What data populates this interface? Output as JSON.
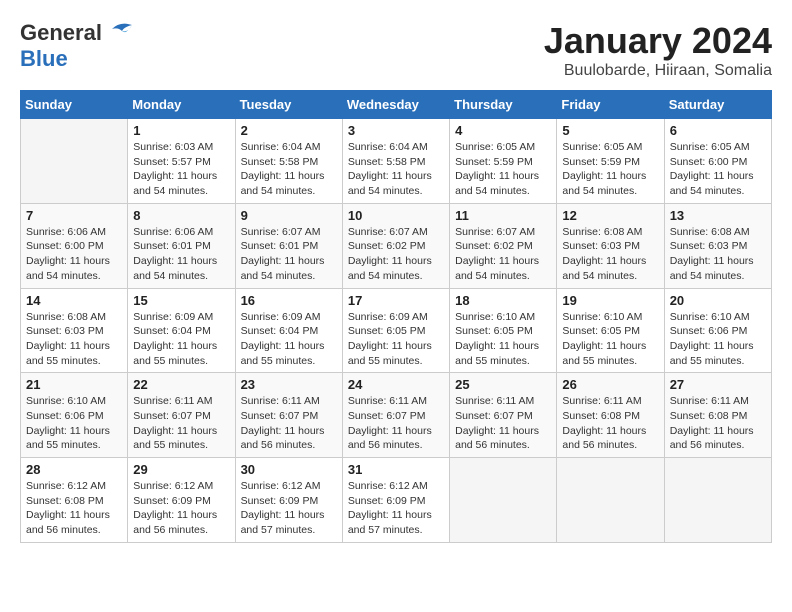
{
  "logo": {
    "general": "General",
    "blue": "Blue"
  },
  "title": "January 2024",
  "subtitle": "Buulobarde, Hiiraan, Somalia",
  "weekdays": [
    "Sunday",
    "Monday",
    "Tuesday",
    "Wednesday",
    "Thursday",
    "Friday",
    "Saturday"
  ],
  "weeks": [
    [
      {
        "day": "",
        "info": ""
      },
      {
        "day": "1",
        "info": "Sunrise: 6:03 AM\nSunset: 5:57 PM\nDaylight: 11 hours\nand 54 minutes."
      },
      {
        "day": "2",
        "info": "Sunrise: 6:04 AM\nSunset: 5:58 PM\nDaylight: 11 hours\nand 54 minutes."
      },
      {
        "day": "3",
        "info": "Sunrise: 6:04 AM\nSunset: 5:58 PM\nDaylight: 11 hours\nand 54 minutes."
      },
      {
        "day": "4",
        "info": "Sunrise: 6:05 AM\nSunset: 5:59 PM\nDaylight: 11 hours\nand 54 minutes."
      },
      {
        "day": "5",
        "info": "Sunrise: 6:05 AM\nSunset: 5:59 PM\nDaylight: 11 hours\nand 54 minutes."
      },
      {
        "day": "6",
        "info": "Sunrise: 6:05 AM\nSunset: 6:00 PM\nDaylight: 11 hours\nand 54 minutes."
      }
    ],
    [
      {
        "day": "7",
        "info": "Sunrise: 6:06 AM\nSunset: 6:00 PM\nDaylight: 11 hours\nand 54 minutes."
      },
      {
        "day": "8",
        "info": "Sunrise: 6:06 AM\nSunset: 6:01 PM\nDaylight: 11 hours\nand 54 minutes."
      },
      {
        "day": "9",
        "info": "Sunrise: 6:07 AM\nSunset: 6:01 PM\nDaylight: 11 hours\nand 54 minutes."
      },
      {
        "day": "10",
        "info": "Sunrise: 6:07 AM\nSunset: 6:02 PM\nDaylight: 11 hours\nand 54 minutes."
      },
      {
        "day": "11",
        "info": "Sunrise: 6:07 AM\nSunset: 6:02 PM\nDaylight: 11 hours\nand 54 minutes."
      },
      {
        "day": "12",
        "info": "Sunrise: 6:08 AM\nSunset: 6:03 PM\nDaylight: 11 hours\nand 54 minutes."
      },
      {
        "day": "13",
        "info": "Sunrise: 6:08 AM\nSunset: 6:03 PM\nDaylight: 11 hours\nand 54 minutes."
      }
    ],
    [
      {
        "day": "14",
        "info": "Sunrise: 6:08 AM\nSunset: 6:03 PM\nDaylight: 11 hours\nand 55 minutes."
      },
      {
        "day": "15",
        "info": "Sunrise: 6:09 AM\nSunset: 6:04 PM\nDaylight: 11 hours\nand 55 minutes."
      },
      {
        "day": "16",
        "info": "Sunrise: 6:09 AM\nSunset: 6:04 PM\nDaylight: 11 hours\nand 55 minutes."
      },
      {
        "day": "17",
        "info": "Sunrise: 6:09 AM\nSunset: 6:05 PM\nDaylight: 11 hours\nand 55 minutes."
      },
      {
        "day": "18",
        "info": "Sunrise: 6:10 AM\nSunset: 6:05 PM\nDaylight: 11 hours\nand 55 minutes."
      },
      {
        "day": "19",
        "info": "Sunrise: 6:10 AM\nSunset: 6:05 PM\nDaylight: 11 hours\nand 55 minutes."
      },
      {
        "day": "20",
        "info": "Sunrise: 6:10 AM\nSunset: 6:06 PM\nDaylight: 11 hours\nand 55 minutes."
      }
    ],
    [
      {
        "day": "21",
        "info": "Sunrise: 6:10 AM\nSunset: 6:06 PM\nDaylight: 11 hours\nand 55 minutes."
      },
      {
        "day": "22",
        "info": "Sunrise: 6:11 AM\nSunset: 6:07 PM\nDaylight: 11 hours\nand 55 minutes."
      },
      {
        "day": "23",
        "info": "Sunrise: 6:11 AM\nSunset: 6:07 PM\nDaylight: 11 hours\nand 56 minutes."
      },
      {
        "day": "24",
        "info": "Sunrise: 6:11 AM\nSunset: 6:07 PM\nDaylight: 11 hours\nand 56 minutes."
      },
      {
        "day": "25",
        "info": "Sunrise: 6:11 AM\nSunset: 6:07 PM\nDaylight: 11 hours\nand 56 minutes."
      },
      {
        "day": "26",
        "info": "Sunrise: 6:11 AM\nSunset: 6:08 PM\nDaylight: 11 hours\nand 56 minutes."
      },
      {
        "day": "27",
        "info": "Sunrise: 6:11 AM\nSunset: 6:08 PM\nDaylight: 11 hours\nand 56 minutes."
      }
    ],
    [
      {
        "day": "28",
        "info": "Sunrise: 6:12 AM\nSunset: 6:08 PM\nDaylight: 11 hours\nand 56 minutes."
      },
      {
        "day": "29",
        "info": "Sunrise: 6:12 AM\nSunset: 6:09 PM\nDaylight: 11 hours\nand 56 minutes."
      },
      {
        "day": "30",
        "info": "Sunrise: 6:12 AM\nSunset: 6:09 PM\nDaylight: 11 hours\nand 57 minutes."
      },
      {
        "day": "31",
        "info": "Sunrise: 6:12 AM\nSunset: 6:09 PM\nDaylight: 11 hours\nand 57 minutes."
      },
      {
        "day": "",
        "info": ""
      },
      {
        "day": "",
        "info": ""
      },
      {
        "day": "",
        "info": ""
      }
    ]
  ]
}
